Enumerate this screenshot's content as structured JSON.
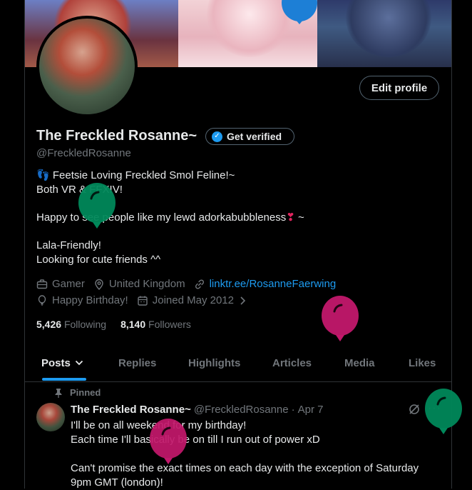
{
  "profile": {
    "name": "The Freckled Rosanne~",
    "handle": "@FreckledRosanne",
    "edit_label": "Edit profile",
    "verify_label": "Get verified",
    "bio": {
      "line1": "Feetsie Loving Freckled Smol Feline!~",
      "line2": "Both VR & FFXIV!",
      "line3": "Happy to see people like my lewd adorkabubbleness",
      "line3_suffix": " ~",
      "line4": "Lala-Friendly!",
      "line5": "Looking for cute friends ^^"
    },
    "meta": {
      "job": "Gamer",
      "location": "United Kingdom",
      "link": "linktr.ee/RosanneFaerwing",
      "birthday": "Happy Birthday!",
      "joined": "Joined May 2012"
    },
    "following_count": "5,426",
    "following_label": "Following",
    "followers_count": "8,140",
    "followers_label": "Followers"
  },
  "tabs": [
    {
      "label": "Posts"
    },
    {
      "label": "Replies"
    },
    {
      "label": "Highlights"
    },
    {
      "label": "Articles"
    },
    {
      "label": "Media"
    },
    {
      "label": "Likes"
    }
  ],
  "pinned_tweet": {
    "pinned_label": "Pinned",
    "author_name": "The Freckled Rosanne~",
    "author_handle": "@FreckledRosanne",
    "separator": "·",
    "date": "Apr 7",
    "lines": [
      "I'll be on all weekend for my birthday!",
      "Each time I'll basically be on till I run out of power xD",
      "",
      "Can't promise the exact times on each day with the exception of Saturday",
      "9pm GMT (london)!"
    ]
  },
  "colors": {
    "accent": "#1d9bf0",
    "balloon_green": "#00885a",
    "balloon_pink": "#c2186b",
    "balloon_blue": "#1d7fd6"
  },
  "icons": [
    "verified-badge-icon",
    "briefcase-icon",
    "location-pin-icon",
    "link-icon",
    "balloon-icon",
    "calendar-icon",
    "chevron-right-icon",
    "chevron-down-icon",
    "pin-icon",
    "grok-icon",
    "more-icon"
  ]
}
